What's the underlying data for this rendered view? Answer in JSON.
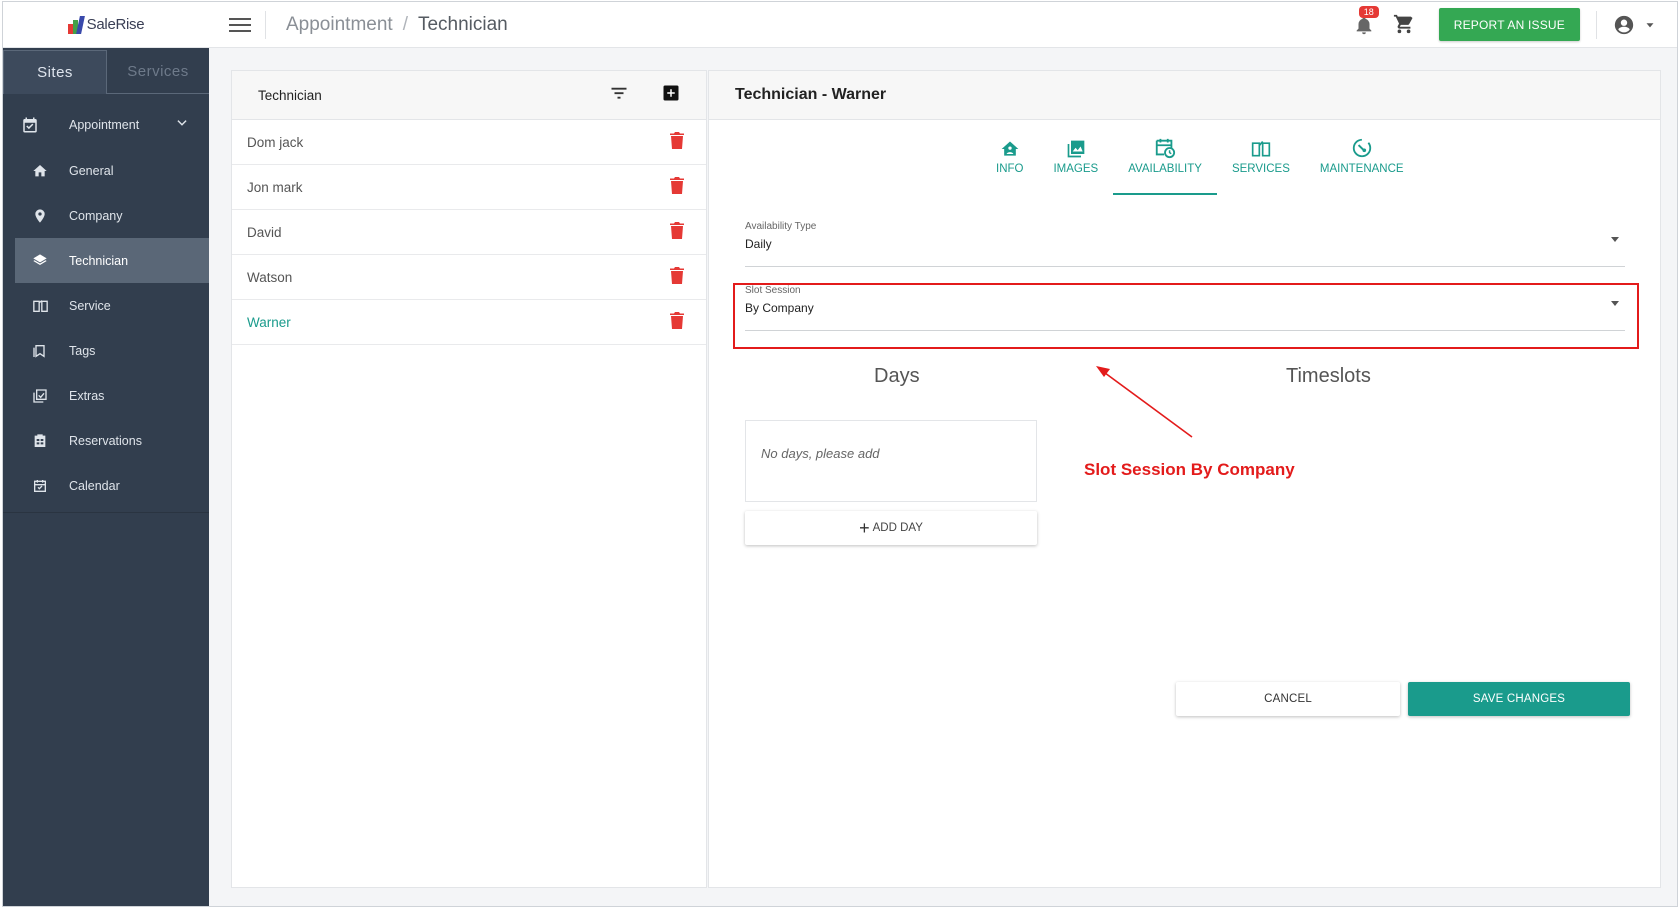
{
  "app": {
    "logo_text": "SaleRise"
  },
  "sidebar": {
    "tabs": [
      {
        "label": "Sites"
      },
      {
        "label": "Services"
      }
    ],
    "parent": {
      "label": "Appointment"
    },
    "items": [
      {
        "label": "General",
        "icon": "home-icon"
      },
      {
        "label": "Company",
        "icon": "location-pin-icon"
      },
      {
        "label": "Technician",
        "icon": "layers-icon"
      },
      {
        "label": "Service",
        "icon": "book-icon"
      },
      {
        "label": "Tags",
        "icon": "tag-icon"
      },
      {
        "label": "Extras",
        "icon": "extras-icon"
      },
      {
        "label": "Reservations",
        "icon": "reservations-icon"
      },
      {
        "label": "Calendar",
        "icon": "calendar-icon"
      }
    ]
  },
  "header": {
    "breadcrumb_root": "Appointment",
    "breadcrumb_sep": "/",
    "breadcrumb_current": "Technician",
    "notification_count": "18",
    "report_label": "REPORT AN ISSUE"
  },
  "list": {
    "title": "Technician",
    "rows": [
      {
        "name": "Dom jack"
      },
      {
        "name": "Jon mark"
      },
      {
        "name": "David"
      },
      {
        "name": "Watson"
      },
      {
        "name": "Warner"
      }
    ]
  },
  "detail": {
    "title": "Technician - Warner",
    "tabs": [
      {
        "label": "INFO"
      },
      {
        "label": "IMAGES"
      },
      {
        "label": "AVAILABILITY"
      },
      {
        "label": "SERVICES"
      },
      {
        "label": "MAINTENANCE"
      }
    ],
    "availability_type": {
      "label": "Availability Type",
      "value": "Daily"
    },
    "slot_session": {
      "label": "Slot Session",
      "value": "By Company"
    },
    "days_title": "Days",
    "timeslots_title": "Timeslots",
    "days_empty": "No days, please add",
    "add_day_label": "ADD DAY",
    "add_day_plus": "+",
    "annotation": "Slot Session By Company",
    "cancel_label": "CANCEL",
    "save_label": "SAVE CHANGES"
  },
  "colors": {
    "sidebar_bg": "#323e4e",
    "accent": "#1a9b8c",
    "report_button": "#34a853",
    "danger": "#e53935",
    "annotation": "#e31b1b"
  }
}
